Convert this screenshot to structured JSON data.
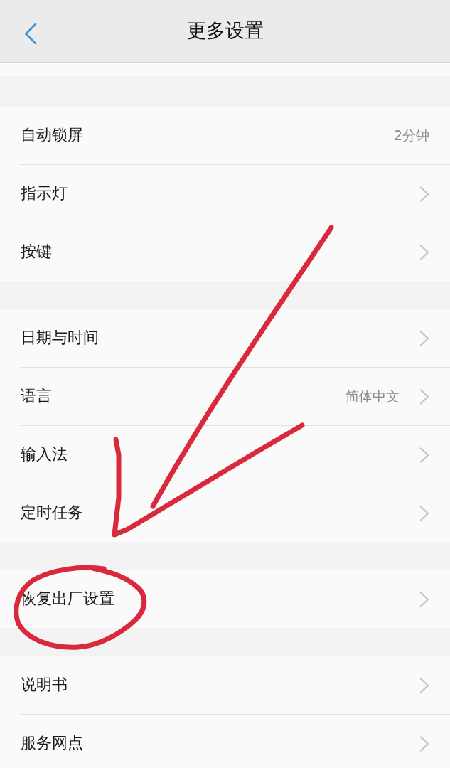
{
  "header": {
    "title": "更多设置"
  },
  "groups": [
    {
      "items": [
        {
          "label": "自动锁屏",
          "value": "2分钟",
          "chevron": false,
          "circled": false
        },
        {
          "label": "指示灯",
          "chevron": true,
          "circled": false
        },
        {
          "label": "按键",
          "chevron": true,
          "circled": false
        }
      ]
    },
    {
      "items": [
        {
          "label": "日期与时间",
          "chevron": true,
          "circled": false
        },
        {
          "label": "语言",
          "value": "简体中文",
          "chevron": true,
          "circled": false
        },
        {
          "label": "输入法",
          "chevron": true,
          "circled": false
        },
        {
          "label": "定时任务",
          "chevron": true,
          "circled": false
        }
      ]
    },
    {
      "items": [
        {
          "label": "恢复出厂设置",
          "chevron": true,
          "circled": true
        }
      ]
    },
    {
      "items": [
        {
          "label": "说明书",
          "chevron": true,
          "circled": false
        },
        {
          "label": "服务网点",
          "chevron": true,
          "circled": false
        }
      ]
    }
  ]
}
